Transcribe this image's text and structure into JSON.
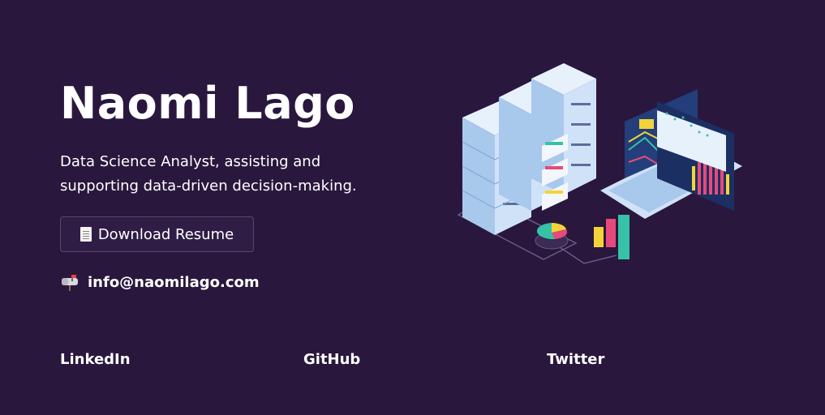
{
  "hero": {
    "name": "Naomi Lago",
    "tagline": "Data Science Analyst, assisting and supporting data-driven decision-making.",
    "resume_button_label": "Download Resume",
    "email": "info@naomilago.com"
  },
  "social_links": [
    {
      "label": "LinkedIn"
    },
    {
      "label": "GitHub"
    },
    {
      "label": "Twitter"
    }
  ],
  "icons": {
    "resume": "document-icon",
    "email": "mailbox-icon"
  },
  "colors": {
    "background": "#2a173d",
    "button_bg": "#2f1d45",
    "button_border": "#57486b",
    "text": "#ffffff"
  }
}
